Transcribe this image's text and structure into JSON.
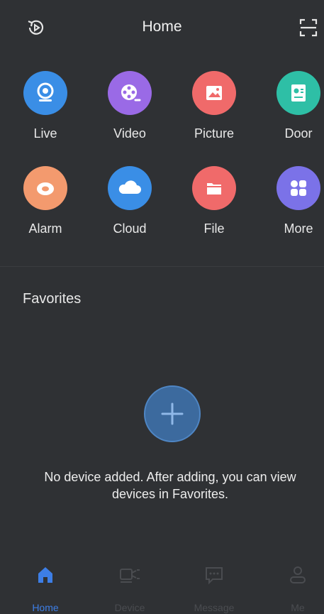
{
  "header": {
    "title": "Home",
    "left_icon": "playback-history-icon",
    "right_icon": "scan-icon"
  },
  "apps": [
    {
      "label": "Live",
      "icon": "camera-icon",
      "color": "#3a8ee6"
    },
    {
      "label": "Video",
      "icon": "film-reel-icon",
      "color": "#9a6ae6"
    },
    {
      "label": "Picture",
      "icon": "picture-icon",
      "color": "#f06a6a"
    },
    {
      "label": "Door",
      "icon": "door-intercom-icon",
      "color": "#2ebfa6"
    },
    {
      "label": "Alarm",
      "icon": "alarm-icon",
      "color": "#f39a6e"
    },
    {
      "label": "Cloud",
      "icon": "cloud-icon",
      "color": "#3a8ee6"
    },
    {
      "label": "File",
      "icon": "folder-icon",
      "color": "#f06a6a"
    },
    {
      "label": "More",
      "icon": "more-grid-icon",
      "color": "#7b72e8"
    }
  ],
  "favorites": {
    "title": "Favorites",
    "empty_message": "No device added. After adding, you can view devices in Favorites."
  },
  "tabs": [
    {
      "label": "Home",
      "icon": "home-icon",
      "active": true
    },
    {
      "label": "Device",
      "icon": "device-camera-icon",
      "active": false
    },
    {
      "label": "Message",
      "icon": "message-icon",
      "active": false
    },
    {
      "label": "Me",
      "icon": "user-icon",
      "active": false
    }
  ],
  "colors": {
    "background": "#2f3134",
    "accent": "#3d7ee6"
  }
}
